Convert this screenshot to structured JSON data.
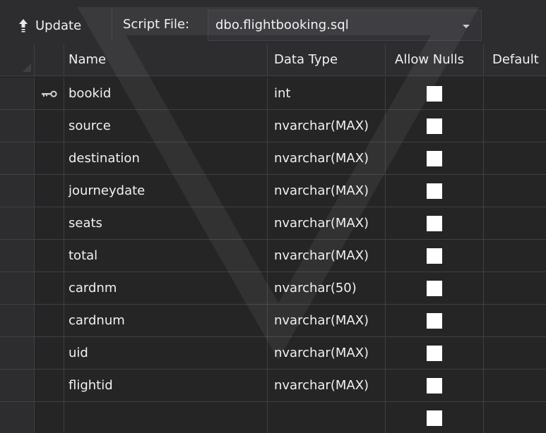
{
  "toolbar": {
    "update_label": "Update",
    "script_file_label": "Script File:",
    "script_file_value": "dbo.flightbooking.sql"
  },
  "columns": [
    "Name",
    "Data Type",
    "Allow Nulls",
    "Default"
  ],
  "rows": [
    {
      "name": "bookid",
      "type": "int",
      "nullable": false,
      "primary_key": true
    },
    {
      "name": "source",
      "type": "nvarchar(MAX)",
      "nullable": false
    },
    {
      "name": "destination",
      "type": "nvarchar(MAX)",
      "nullable": false
    },
    {
      "name": "journeydate",
      "type": "nvarchar(MAX)",
      "nullable": false
    },
    {
      "name": "seats",
      "type": "nvarchar(MAX)",
      "nullable": false
    },
    {
      "name": "total",
      "type": "nvarchar(MAX)",
      "nullable": false
    },
    {
      "name": "cardnm",
      "type": "nvarchar(50)",
      "nullable": false
    },
    {
      "name": "cardnum",
      "type": "nvarchar(MAX)",
      "nullable": false
    },
    {
      "name": "uid",
      "type": "nvarchar(MAX)",
      "nullable": false
    },
    {
      "name": "flightid",
      "type": "nvarchar(MAX)",
      "nullable": false
    },
    {
      "name": "",
      "type": "",
      "nullable": false
    }
  ],
  "icons": {
    "update": "upload-arrow-icon",
    "primary_key": "key-icon",
    "dropdown": "chevron-down-icon"
  },
  "colors": {
    "background": "#252526",
    "toolbar": "#2d2d30",
    "grid_line": "#3f3f46",
    "text": "#f1f1f1",
    "checkbox": "#ffffff"
  }
}
